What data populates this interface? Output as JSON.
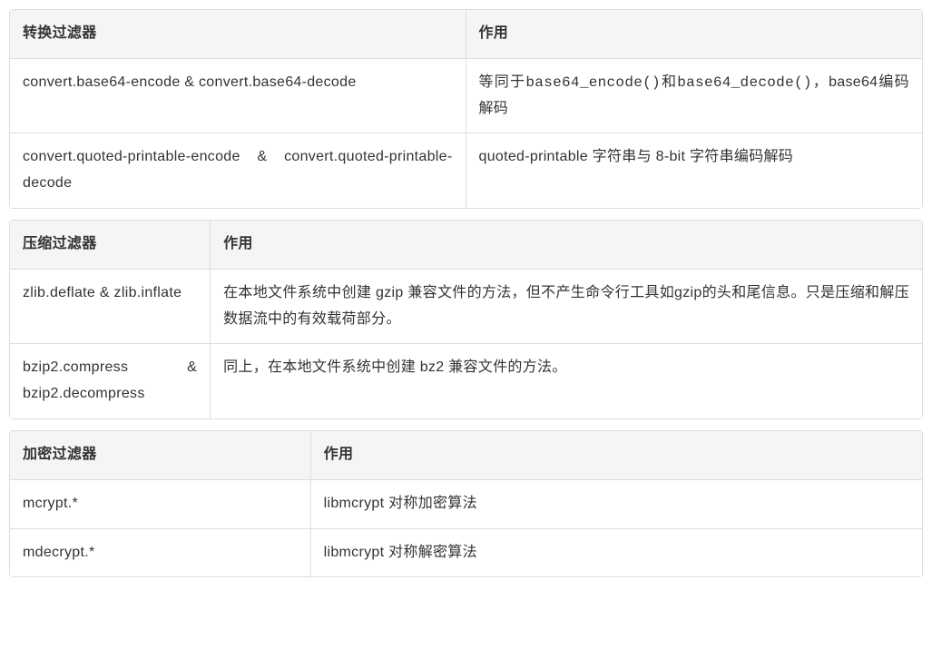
{
  "tables": {
    "convert": {
      "headers": [
        "转换过滤器",
        "作用"
      ],
      "rows": [
        {
          "filter_prefix": "convert.base64-encode ",
          "filter_sep": " & ",
          "filter_suffix": " convert.base64-decode",
          "effect_prefix": "等同于",
          "effect_code1": "base64_encode()",
          "effect_mid": "和",
          "effect_code2": "base64_decode()",
          "effect_suffix": "，base64编码解码"
        },
        {
          "filter_prefix": "convert.quoted-printable-encode ",
          "filter_sep": " & ",
          "filter_suffix": " convert.quoted-printable-decode",
          "effect": "quoted-printable 字符串与 8-bit 字符串编码解码"
        }
      ]
    },
    "compress": {
      "headers": [
        "压缩过滤器",
        "作用"
      ],
      "rows": [
        {
          "filter": "zlib.deflate & zlib.inflate",
          "effect": "在本地文件系统中创建 gzip 兼容文件的方法，但不产生命令行工具如gzip的头和尾信息。只是压缩和解压数据流中的有效载荷部分。"
        },
        {
          "filter": "bzip2.compress & bzip2.decompress",
          "effect": "同上，在本地文件系统中创建 bz2 兼容文件的方法。"
        }
      ]
    },
    "encrypt": {
      "headers": [
        "加密过滤器",
        "作用"
      ],
      "rows": [
        {
          "filter": "mcrypt.*",
          "effect": "libmcrypt 对称加密算法"
        },
        {
          "filter": "mdecrypt.*",
          "effect": "libmcrypt 对称解密算法"
        }
      ]
    }
  }
}
